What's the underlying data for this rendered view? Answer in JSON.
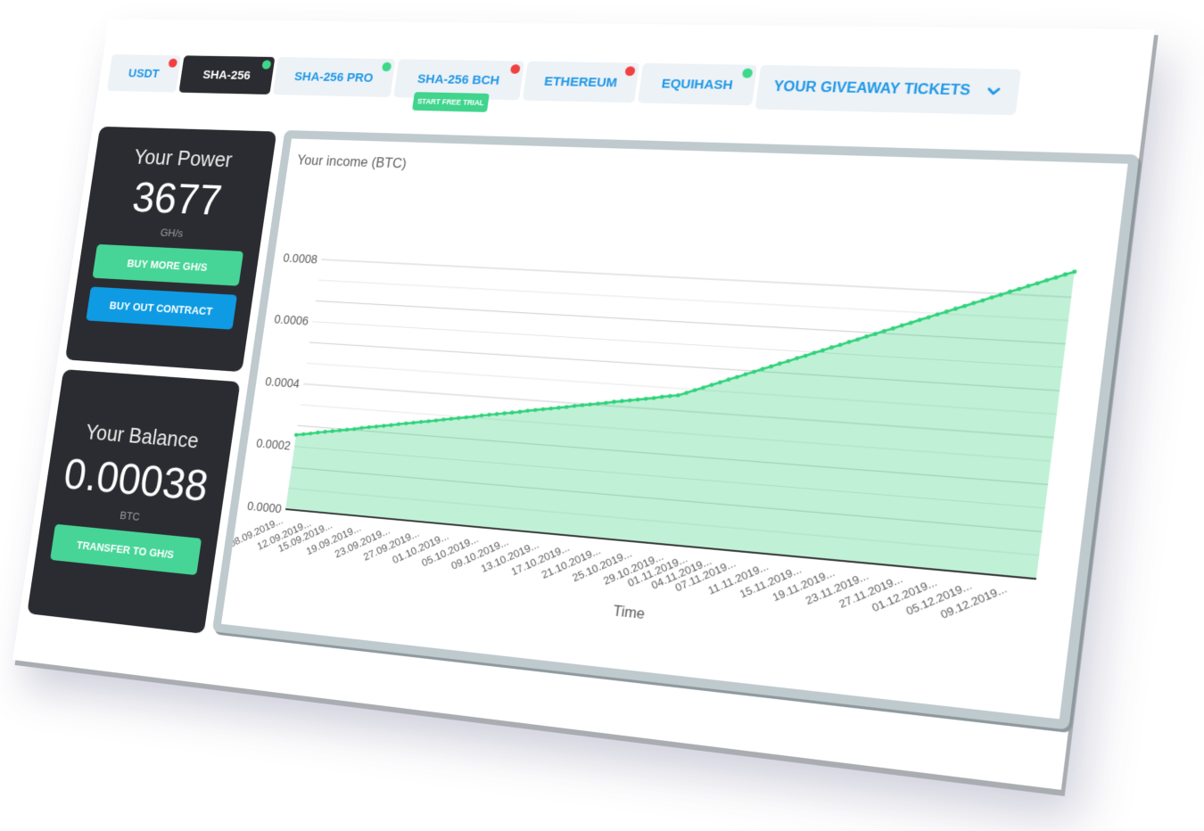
{
  "tabs": [
    {
      "label": "USDT",
      "status": "red",
      "active": false
    },
    {
      "label": "SHA-256",
      "status": "green",
      "active": true
    },
    {
      "label": "SHA-256 PRO",
      "status": "green",
      "active": false
    },
    {
      "label": "SHA-256 BCH",
      "status": "red",
      "active": false,
      "badge": "START FREE TRIAL"
    },
    {
      "label": "ETHEREUM",
      "status": "red",
      "active": false
    },
    {
      "label": "EQUIHASH",
      "status": "green",
      "active": false
    }
  ],
  "giveaway": {
    "label": "YOUR GIVEAWAY TICKETS",
    "icon": "chevron-down-icon"
  },
  "power": {
    "title": "Your Power",
    "value": "3677",
    "unit": "GH/s",
    "buy_more_label": "BUY MORE GH/S",
    "buy_out_label": "BUY OUT CONTRACT"
  },
  "balance": {
    "title": "Your Balance",
    "value": "0.00038",
    "unit": "BTC",
    "transfer_label": "TRANSFER TO GH/S"
  },
  "colors": {
    "tab_text": "#1f98e6",
    "tab_bg": "#edf2f7",
    "active_tab_bg": "#2b2c31",
    "card_bg": "#2b2c31",
    "green_button": "#46d597",
    "blue_button": "#0e9be3",
    "status": {
      "red": "#f0403f",
      "green": "#3fd88a"
    },
    "chart_frame": "#bfcace"
  },
  "chart_data": {
    "type": "area",
    "title": "Your income (BTC)",
    "xlabel": "Time",
    "ylabel": "",
    "ylim": [
      0,
      0.0008
    ],
    "y_ticks": [
      0,
      0.0002,
      0.0004,
      0.0006,
      0.0008
    ],
    "y_tick_labels": [
      "0.0000",
      "0.0002",
      "0.0004",
      "0.0006",
      "0.0008"
    ],
    "grid": true,
    "grid_lines_per_tick": 3,
    "legend": "none",
    "x": [
      "08.09.2019",
      "09.09.2019",
      "10.09.2019",
      "11.09.2019",
      "12.09.2019",
      "13.09.2019",
      "14.09.2019",
      "15.09.2019",
      "16.09.2019",
      "17.09.2019",
      "18.09.2019",
      "19.09.2019",
      "20.09.2019",
      "21.09.2019",
      "22.09.2019",
      "23.09.2019",
      "24.09.2019",
      "25.09.2019",
      "26.09.2019",
      "27.09.2019",
      "28.09.2019",
      "29.09.2019",
      "30.09.2019",
      "01.10.2019",
      "02.10.2019",
      "03.10.2019",
      "04.10.2019",
      "05.10.2019",
      "06.10.2019",
      "07.10.2019",
      "08.10.2019",
      "09.10.2019",
      "10.10.2019",
      "11.10.2019",
      "12.10.2019",
      "13.10.2019",
      "14.10.2019",
      "15.10.2019",
      "16.10.2019",
      "17.10.2019",
      "18.10.2019",
      "19.10.2019",
      "20.10.2019",
      "21.10.2019",
      "22.10.2019",
      "23.10.2019",
      "24.10.2019",
      "25.10.2019",
      "26.10.2019",
      "27.10.2019",
      "28.10.2019",
      "29.10.2019",
      "30.10.2019",
      "31.10.2019",
      "01.11.2019",
      "02.11.2019",
      "03.11.2019",
      "04.11.2019",
      "05.11.2019",
      "06.11.2019",
      "07.11.2019",
      "08.11.2019",
      "09.11.2019",
      "10.11.2019",
      "11.11.2019",
      "12.11.2019",
      "13.11.2019",
      "14.11.2019",
      "15.11.2019",
      "16.11.2019",
      "17.11.2019",
      "18.11.2019",
      "19.11.2019",
      "20.11.2019",
      "21.11.2019",
      "22.11.2019",
      "23.11.2019",
      "24.11.2019",
      "25.11.2019",
      "26.11.2019",
      "27.11.2019",
      "28.11.2019",
      "29.11.2019",
      "30.11.2019",
      "01.12.2019",
      "02.12.2019",
      "03.12.2019",
      "04.12.2019",
      "05.12.2019",
      "06.12.2019",
      "07.12.2019",
      "08.12.2019",
      "09.12.2019",
      "10.12.2019",
      "11.12.2019",
      "12.12.2019"
    ],
    "x_tick_labels": [
      "08.09.2019...",
      "12.09.2019...",
      "15.09.2019...",
      "19.09.2019...",
      "23.09.2019...",
      "27.09.2019...",
      "01.10.2019...",
      "05.10.2019...",
      "09.10.2019...",
      "13.10.2019...",
      "17.10.2019...",
      "21.10.2019...",
      "25.10.2019...",
      "29.10.2019...",
      "01.11.2019...",
      "04.11.2019...",
      "07.11.2019...",
      "11.11.2019...",
      "15.11.2019...",
      "19.11.2019...",
      "23.11.2019...",
      "27.11.2019...",
      "01.12.2019...",
      "05.12.2019...",
      "09.12.2019..."
    ],
    "series": [
      {
        "name": "Your income (BTC)",
        "color": "#2fd27a",
        "values": [
          0.000237,
          0.000241,
          0.000245,
          0.00025,
          0.000254,
          0.000258,
          0.000262,
          0.000266,
          0.00027,
          0.000275,
          0.000279,
          0.000283,
          0.000287,
          0.000291,
          0.000296,
          0.0003,
          0.000304,
          0.000308,
          0.000312,
          0.000316,
          0.000321,
          0.000325,
          0.000329,
          0.000333,
          0.000337,
          0.000342,
          0.000346,
          0.00035,
          0.000354,
          0.000358,
          0.000362,
          0.000367,
          0.000371,
          0.000375,
          0.000379,
          0.000383,
          0.000387,
          0.000392,
          0.000396,
          0.0004,
          0.000404,
          0.000408,
          0.000413,
          0.000417,
          0.000421,
          0.000425,
          0.000429,
          0.000433,
          0.000438,
          0.000442,
          0.000446,
          0.000455,
          0.000465,
          0.000474,
          0.000484,
          0.000493,
          0.000503,
          0.000512,
          0.000522,
          0.000531,
          0.000541,
          0.00055,
          0.00056,
          0.000569,
          0.000579,
          0.000588,
          0.000598,
          0.000607,
          0.000617,
          0.000626,
          0.000636,
          0.000645,
          0.000655,
          0.000664,
          0.000674,
          0.000683,
          0.000693,
          0.000702,
          0.000712,
          0.000721,
          0.000731,
          0.00074,
          0.00075,
          0.000759,
          0.000769,
          0.000778,
          0.000788,
          0.000797,
          0.000807,
          0.000816,
          0.000826,
          0.000835,
          0.000845,
          0.000854,
          0.000864,
          0.000873
        ]
      }
    ]
  }
}
